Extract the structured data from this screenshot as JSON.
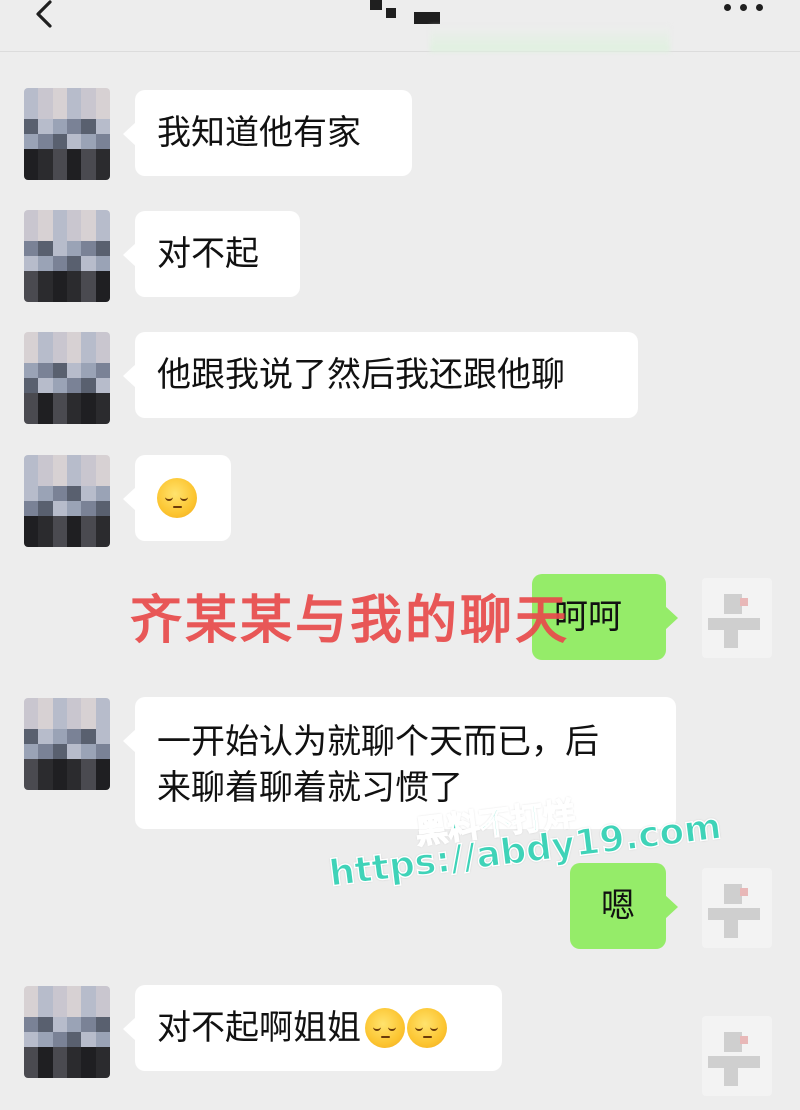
{
  "messages": [
    {
      "text": "我知道他有家"
    },
    {
      "text": "对不起"
    },
    {
      "text": "他跟我说了然后我还跟他聊"
    },
    {
      "emoji": "pensive-face"
    },
    {
      "text": "呵呵"
    },
    {
      "line1": "一开始认为就聊个天而已，后",
      "line2": "来聊着聊着就习惯了"
    },
    {
      "text": "嗯"
    },
    {
      "text": "对不起啊姐姐",
      "emoji": "pensive-face"
    }
  ],
  "overlay": {
    "caption": "齐某某与我的聊天"
  },
  "watermark": {
    "line1": "黑料不打烊",
    "line2": "https://abdy19.com"
  },
  "colors": {
    "background": "#ededed",
    "bubble_in": "#ffffff",
    "bubble_out": "#95ec69",
    "caption": "#e84b4b",
    "watermark": "#3fd3b8"
  }
}
